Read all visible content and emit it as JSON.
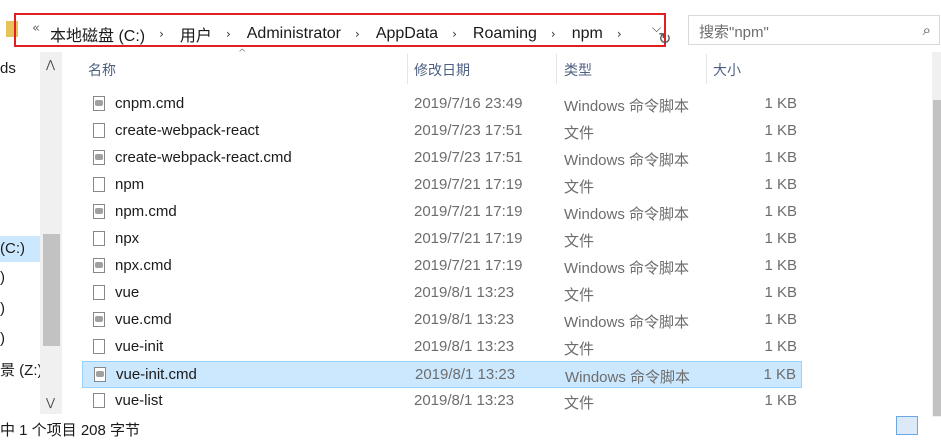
{
  "address": {
    "lead": "«",
    "crumbs": [
      "本地磁盘 (C:)",
      "用户",
      "Administrator",
      "AppData",
      "Roaming",
      "npm"
    ],
    "separator": "›",
    "dropdown": "⌵",
    "refresh": "↻"
  },
  "search": {
    "placeholder": "搜索\"npm\"",
    "icon": "⌕"
  },
  "nav": {
    "items": [
      {
        "label": "ds"
      },
      {
        "label": "(C:)",
        "selected": true
      },
      {
        "label": ")"
      },
      {
        "label": ")"
      },
      {
        "label": ")"
      },
      {
        "label": "景 (Z:)"
      }
    ],
    "scroll_up": "⋀",
    "scroll_down": "⋁"
  },
  "columns": {
    "name": "名称",
    "date": "修改日期",
    "type": "类型",
    "size": "大小",
    "sort_indicator": "^"
  },
  "files": [
    {
      "name": "cnpm.cmd",
      "date": "2019/7/16 23:49",
      "type": "Windows 命令脚本",
      "size": "1 KB",
      "kind": "cmd"
    },
    {
      "name": "create-webpack-react",
      "date": "2019/7/23 17:51",
      "type": "文件",
      "size": "1 KB",
      "kind": "file"
    },
    {
      "name": "create-webpack-react.cmd",
      "date": "2019/7/23 17:51",
      "type": "Windows 命令脚本",
      "size": "1 KB",
      "kind": "cmd"
    },
    {
      "name": "npm",
      "date": "2019/7/21 17:19",
      "type": "文件",
      "size": "1 KB",
      "kind": "file"
    },
    {
      "name": "npm.cmd",
      "date": "2019/7/21 17:19",
      "type": "Windows 命令脚本",
      "size": "1 KB",
      "kind": "cmd"
    },
    {
      "name": "npx",
      "date": "2019/7/21 17:19",
      "type": "文件",
      "size": "1 KB",
      "kind": "file"
    },
    {
      "name": "npx.cmd",
      "date": "2019/7/21 17:19",
      "type": "Windows 命令脚本",
      "size": "1 KB",
      "kind": "cmd"
    },
    {
      "name": "vue",
      "date": "2019/8/1 13:23",
      "type": "文件",
      "size": "1 KB",
      "kind": "file"
    },
    {
      "name": "vue.cmd",
      "date": "2019/8/1 13:23",
      "type": "Windows 命令脚本",
      "size": "1 KB",
      "kind": "cmd"
    },
    {
      "name": "vue-init",
      "date": "2019/8/1 13:23",
      "type": "文件",
      "size": "1 KB",
      "kind": "file"
    },
    {
      "name": "vue-init.cmd",
      "date": "2019/8/1 13:23",
      "type": "Windows 命令脚本",
      "size": "1 KB",
      "kind": "cmd",
      "selected": true
    },
    {
      "name": "vue-list",
      "date": "2019/8/1 13:23",
      "type": "文件",
      "size": "1 KB",
      "kind": "file"
    }
  ],
  "status": {
    "text": "中 1 个项目 208 字节"
  },
  "colors": {
    "selection": "#cce8ff",
    "highlight_border": "#e02020",
    "header_text": "#4d6082"
  }
}
